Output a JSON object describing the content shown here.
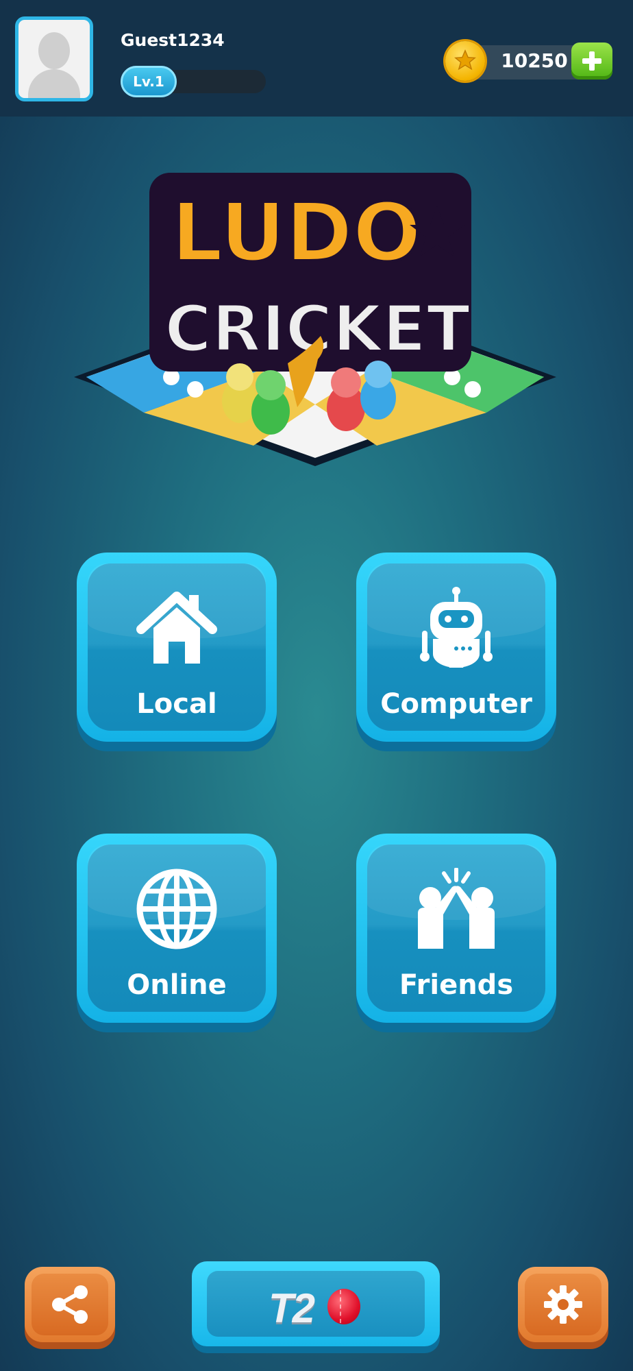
{
  "profile": {
    "username": "Guest1234",
    "level_label": "Lv.1",
    "level_progress": 0
  },
  "wallet": {
    "coins": "10250"
  },
  "logo": {
    "line1": "LUDO",
    "line2": "CRICKET"
  },
  "menu": {
    "local_label": "Local",
    "computer_label": "Computer",
    "online_label": "Online",
    "friends_label": "Friends"
  },
  "bottom": {
    "t20_label": "T2"
  },
  "colors": {
    "tile_face": "#18b7ea",
    "orange_button": "#e27a2e",
    "coin": "#f4b400",
    "add_button": "#4fb514"
  },
  "icons": {
    "avatar": "avatar-silhouette-icon",
    "coin": "star-coin-icon",
    "add": "plus-icon",
    "local": "house-icon",
    "computer": "robot-icon",
    "online": "globe-icon",
    "friends": "high-five-icon",
    "share": "share-icon",
    "settings": "gear-icon",
    "t20": "cricket-ball-icon"
  }
}
